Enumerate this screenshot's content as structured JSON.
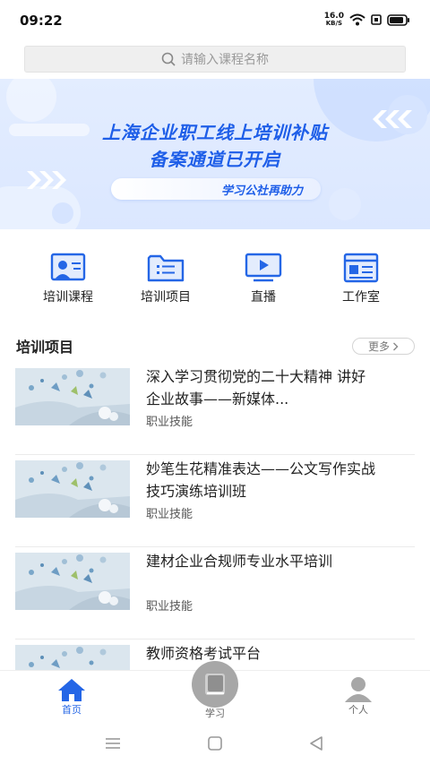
{
  "status_bar": {
    "time": "09:22",
    "net_speed_value": "16.0",
    "net_speed_unit": "KB/S",
    "battery_icon": "battery-icon",
    "wifi_icon": "wifi-icon"
  },
  "search": {
    "placeholder": "请输入课程名称"
  },
  "banner": {
    "title_line1": "上海企业职工线上培训补贴",
    "title_line2": "备案通道已开启",
    "pill_text": "学习公社再助力",
    "accent_color": "#1e5ee8"
  },
  "quick_nav": [
    {
      "label": "培训课程",
      "icon": "training-course-icon"
    },
    {
      "label": "培训项目",
      "icon": "training-project-icon"
    },
    {
      "label": "直播",
      "icon": "live-icon"
    },
    {
      "label": "工作室",
      "icon": "studio-icon"
    }
  ],
  "section": {
    "title": "培训项目",
    "more_label": "更多"
  },
  "courses": [
    {
      "title": "深入学习贯彻党的二十大精神 讲好企业故事——新媒体...",
      "tag": "职业技能"
    },
    {
      "title": "妙笔生花精准表达——公文写作实战技巧演练培训班",
      "tag": "职业技能"
    },
    {
      "title": "建材企业合规师专业水平培训",
      "tag": "职业技能"
    },
    {
      "title": "教师资格考试平台",
      "tag": ""
    }
  ],
  "tab_bar": [
    {
      "label": "首页",
      "icon": "home-icon",
      "active": true
    },
    {
      "label": "学习",
      "icon": "book-icon",
      "active": false
    },
    {
      "label": "个人",
      "icon": "user-icon",
      "active": false
    }
  ],
  "colors": {
    "primary": "#2466e6",
    "inactive": "#a7a7a7"
  }
}
